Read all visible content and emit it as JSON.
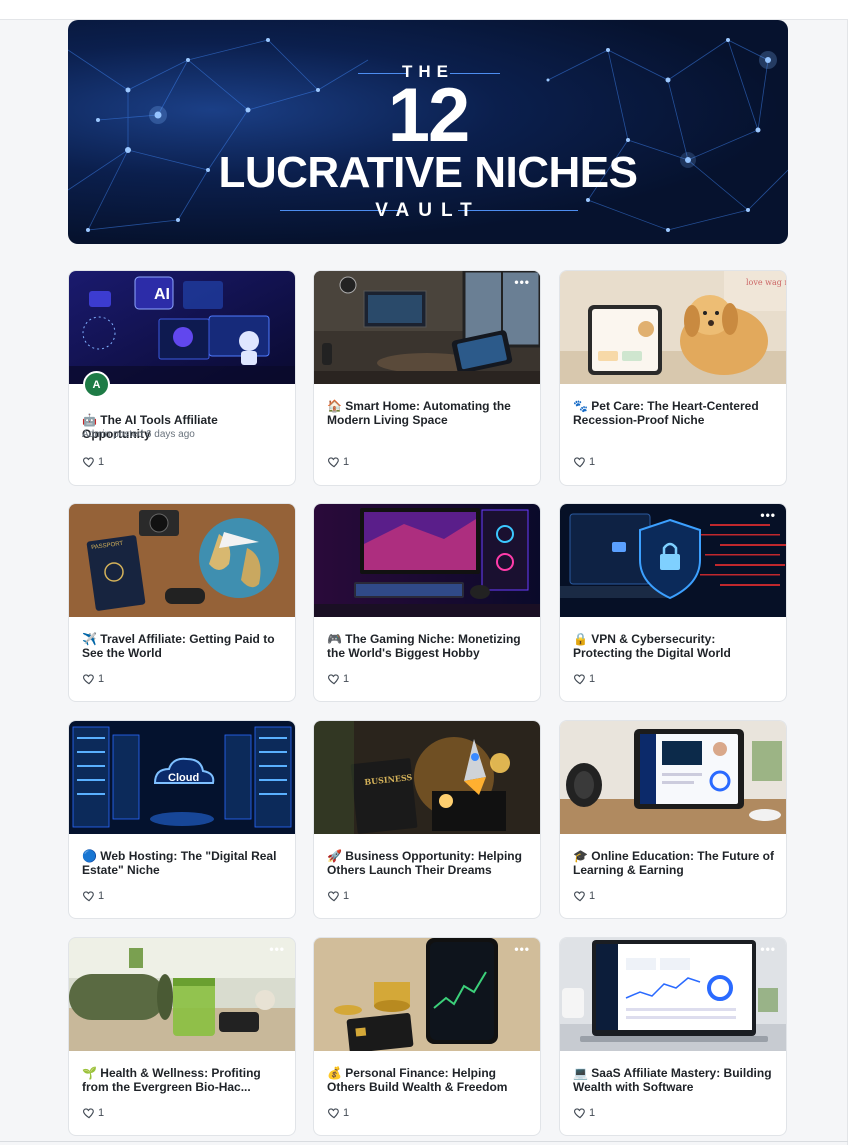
{
  "hero": {
    "line1": "THE",
    "line2": "12",
    "line3": "LUCRATIVE NICHES",
    "line4": "VAULT"
  },
  "cards": [
    {
      "title": "🤖 The AI Tools Affiliate Opportunity",
      "meta": "Admin posted 6 days ago",
      "avatar": "A",
      "likes": "1",
      "thumb_label": "AI",
      "theme": "ai-tools-icon"
    },
    {
      "title": "🏠 Smart Home: Automating the Modern Living Space",
      "likes": "1",
      "theme": "smart-home-icon"
    },
    {
      "title": "🐾 Pet Care: The Heart-Centered Recession-Proof Niche",
      "likes": "1",
      "thumb_label": "love wag repeat",
      "theme": "pet-care-icon"
    },
    {
      "title": "✈️ Travel Affiliate: Getting Paid to See the World",
      "likes": "1",
      "thumb_label": "PASSPORT",
      "theme": "travel-icon"
    },
    {
      "title": "🎮 The Gaming Niche: Monetizing the World's Biggest Hobby",
      "likes": "1",
      "theme": "gaming-icon"
    },
    {
      "title": "🔒 VPN & Cybersecurity: Protecting the Digital World",
      "likes": "1",
      "theme": "cybersecurity-icon"
    },
    {
      "title": "🔵 Web Hosting: The \"Digital Real Estate\" Niche",
      "likes": "1",
      "thumb_label": "Cloud",
      "theme": "web-hosting-icon"
    },
    {
      "title": "🚀 Business Opportunity: Helping Others Launch Their Dreams",
      "likes": "1",
      "thumb_label": "BUSINESS",
      "theme": "business-icon"
    },
    {
      "title": "🎓 Online Education: The Future of Learning & Earning",
      "likes": "1",
      "theme": "education-icon"
    },
    {
      "title": "🌱 Health & Wellness: Profiting from the Evergreen Bio-Hac...",
      "likes": "1",
      "theme": "wellness-icon"
    },
    {
      "title": "💰 Personal Finance: Helping Others Build Wealth & Freedom",
      "likes": "1",
      "theme": "finance-icon"
    },
    {
      "title": "💻 SaaS Affiliate Mastery: Building Wealth with Software",
      "likes": "1",
      "theme": "saas-icon"
    }
  ],
  "more_icon_text": "•••",
  "colors": {
    "page_bg": "#f5f6f8",
    "hero_bg": "#06122e",
    "avatar_bg": "#1e7b46"
  }
}
